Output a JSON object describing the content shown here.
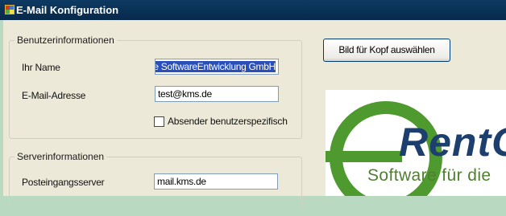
{
  "window": {
    "title": "E-Mail Konfiguration"
  },
  "user_group": {
    "legend": "Benutzerinformationen",
    "name_label": "Ihr Name",
    "name_value": "le SoftwareEntwicklung GmbH",
    "email_label": "E-Mail-Adresse",
    "email_value": "test@kms.de",
    "checkbox_label": "Absender benutzerspezifisch",
    "checkbox_checked": false
  },
  "server_group": {
    "legend": "Serverinformationen",
    "incoming_label": "Posteingangsserver",
    "incoming_value": "mail.kms.de"
  },
  "header_image": {
    "button_label": "Bild für Kopf auswählen",
    "logo_text": "RentO",
    "logo_subtitle": "Software für die"
  },
  "colors": {
    "titlebar": "#0d3a63",
    "client_bg": "#ece9d8",
    "selection": "#2b4fb8",
    "logo_green": "#4f9a2f",
    "logo_blue": "#1d3f6e",
    "outer_bg": "#b9d9c1"
  },
  "icons": {
    "title_icon": "form-icon",
    "logo_graphic": "green-wheel-logo"
  }
}
